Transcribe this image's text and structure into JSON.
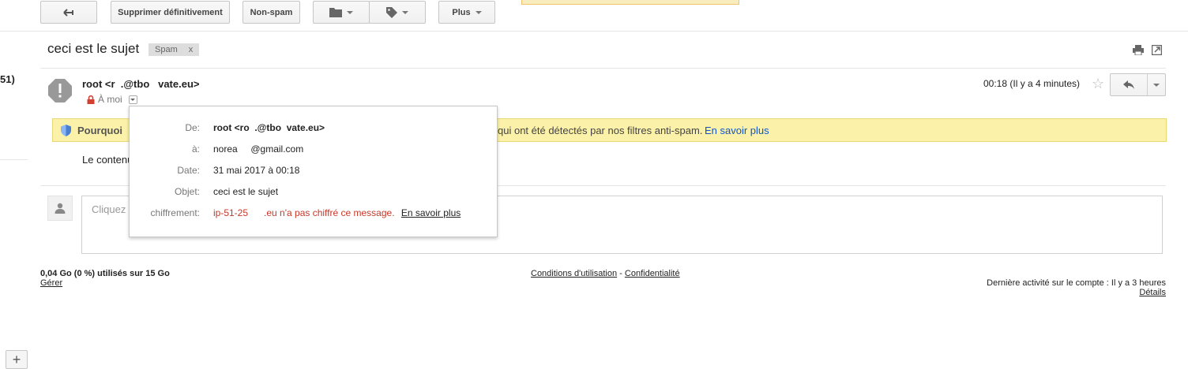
{
  "toolbar": {
    "delete_forever": "Supprimer définitivement",
    "not_spam": "Non-spam",
    "more": "Plus"
  },
  "left": {
    "count": "51)",
    "add": "+"
  },
  "message": {
    "subject": "ceci est le sujet",
    "label": "Spam",
    "label_remove": "x",
    "sender": "root <r  .@tbo   vate.eu>",
    "to_me": "À moi",
    "time": "00:18 (Il y a 4 minutes)",
    "star": "☆"
  },
  "spam_warning": {
    "why": "Pourquoi",
    "rest": "qui ont été détectés par nos filtres anti-spam.",
    "learn_more": "En savoir plus"
  },
  "body_text": "Le contenu",
  "reply_box": {
    "placeholder": "Cliquez"
  },
  "details_popup": {
    "from_label": "De:",
    "from_value": "root <ro  .@tbo  vate.eu>",
    "to_label": "à:",
    "to_value": "norea     @gmail.com",
    "date_label": "Date:",
    "date_value": "31 mai 2017 à 00:18",
    "subject_label": "Objet:",
    "subject_value": "ceci est le sujet",
    "encryption_label": "chiffrement:",
    "encryption_value": "ip-51-25      .eu n'a pas chiffré ce message.",
    "encryption_link": "En savoir plus"
  },
  "footer": {
    "storage": "0,04 Go (0 %) utilisés sur 15 Go",
    "manage": "Gérer",
    "terms": "Conditions d'utilisation",
    "separator": " - ",
    "privacy": "Confidentialité",
    "last_activity": "Dernière activité sur le compte : Il y a 3 heures",
    "details": "Détails"
  },
  "colors": {
    "spam_bar_bg": "#fbf1a9",
    "link_blue": "#1155cc",
    "encryption_red": "#c53929",
    "lock_red": "#d23f31"
  }
}
